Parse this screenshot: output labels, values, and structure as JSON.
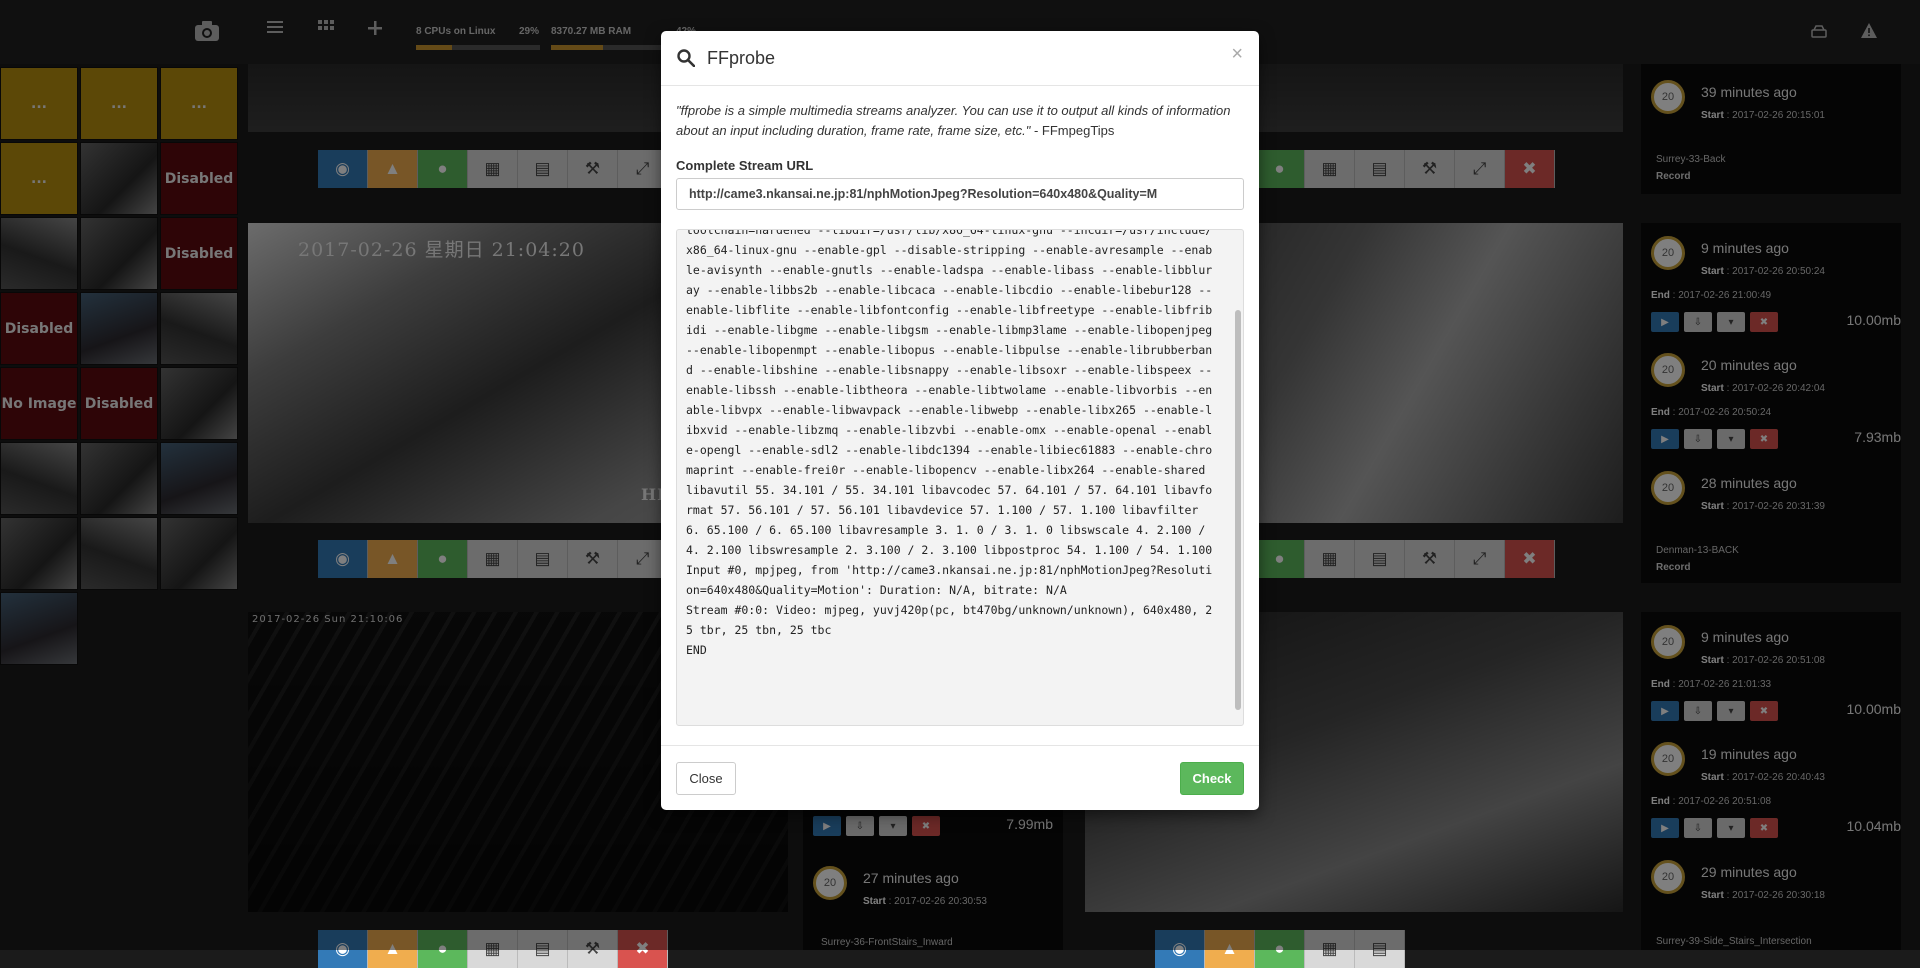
{
  "topbar": {
    "cpu_label": "8 CPUs on Linux",
    "cpu_percent": "29%",
    "ram_label": "8370.27 MB RAM",
    "ram_percent": "42%",
    "cpu_fraction": 0.29,
    "ram_fraction": 0.42
  },
  "left_grid": {
    "tiles": [
      "...",
      "...",
      "...",
      "...",
      "Disabled",
      "Disabled",
      "Disabled",
      "No Image",
      "Disabled"
    ]
  },
  "cameras": {
    "cam1_timestamp": "2017-02-26 星期日 21:04:20",
    "cam1_corner": "HI",
    "cam3_timestamp": "2017-02-26 Sun 21:10:06"
  },
  "recordings": {
    "panel1": [
      {
        "ago": "39 minutes ago",
        "start_label": "Start",
        "start": "2017-02-26 20:15:01",
        "circle": "20"
      }
    ],
    "panel1_camera": "Surrey-33-Back",
    "panel1_mode": "Record",
    "panel2": [
      {
        "ago": "9 minutes ago",
        "start_label": "Start",
        "start": "2017-02-26 20:50:24",
        "end_label": "End",
        "end": "2017-02-26 21:00:49",
        "size": "10.00mb",
        "circle": "20"
      },
      {
        "ago": "20 minutes ago",
        "start_label": "Start",
        "start": "2017-02-26 20:42:04",
        "end_label": "End",
        "end": "2017-02-26 20:50:24",
        "size": "7.93mb",
        "circle": "20"
      },
      {
        "ago": "28 minutes ago",
        "start_label": "Start",
        "start": "2017-02-26 20:31:39",
        "circle": "20"
      }
    ],
    "panel2_camera": "Denman-13-BACK",
    "panel2_mode": "Record",
    "panel3": [
      {
        "ago": "9 minutes ago",
        "start_label": "Start",
        "start": "2017-02-26 20:51:08",
        "end_label": "End",
        "end": "2017-02-26 21:01:33",
        "size": "10.00mb",
        "circle": "20"
      },
      {
        "ago": "19 minutes ago",
        "start_label": "Start",
        "start": "2017-02-26 20:40:43",
        "end_label": "End",
        "end": "2017-02-26 20:51:08",
        "size": "10.04mb",
        "circle": "20"
      },
      {
        "ago": "29 minutes ago",
        "start_label": "Start",
        "start": "2017-02-26 20:30:18",
        "circle": "20"
      }
    ],
    "panel3_camera": "Surrey-39-Side_Stairs_Intersection",
    "mid_size": "7.99mb",
    "mid_rec": {
      "ago": "27 minutes ago",
      "start_label": "Start",
      "start": "2017-02-26 20:30:53",
      "circle": "20"
    },
    "mid_camera": "Surrey-36-FrontStairs_Inward"
  },
  "modal": {
    "title": "FFprobe",
    "close_x": "×",
    "description_quote": "\"ffprobe is a simple multimedia streams analyzer. You can use it to output all kinds of information about an input including duration, frame rate, frame size, etc.\"",
    "description_source": " - FFmpegTips",
    "url_label": "Complete Stream URL",
    "url_value": "http://came3.nkansai.ne.jp:81/nphMotionJpeg?Resolution=640x480&Quality=M",
    "output": "toolchain=hardened --libdir=/usr/lib/x86_64-linux-gnu --incdir=/usr/include/x86_64-linux-gnu --enable-gpl --disable-stripping --enable-avresample --enable-avisynth --enable-gnutls --enable-ladspa --enable-libass --enable-libbluray --enable-libbs2b --enable-libcaca --enable-libcdio --enable-libebur128 --enable-libflite --enable-libfontconfig --enable-libfreetype --enable-libfribidi --enable-libgme --enable-libgsm --enable-libmp3lame --enable-libopenjpeg --enable-libopenmpt --enable-libopus --enable-libpulse --enable-librubberband --enable-libshine --enable-libsnappy --enable-libsoxr --enable-libspeex --enable-libssh --enable-libtheora --enable-libtwolame --enable-libvorbis --enable-libvpx --enable-libwavpack --enable-libwebp --enable-libx265 --enable-libxvid --enable-libzmq --enable-libzvbi --enable-omx --enable-openal --enable-opengl --enable-sdl2 --enable-libdc1394 --enable-libiec61883 --enable-chromaprint --enable-frei0r --enable-libopencv --enable-libx264 --enable-shared\nlibavutil 55. 34.101 / 55. 34.101 libavcodec 57. 64.101 / 57. 64.101 libavformat 57. 56.101 / 57. 56.101 libavdevice 57. 1.100 / 57. 1.100 libavfilter 6. 65.100 / 6. 65.100 libavresample 3. 1. 0 / 3. 1. 0 libswscale 4. 2.100 / 4. 2.100 libswresample 2. 3.100 / 2. 3.100 libpostproc 54. 1.100 / 54. 1.100\nInput #0, mpjpeg, from 'http://came3.nkansai.ne.jp:81/nphMotionJpeg?Resolution=640x480&Quality=Motion': Duration: N/A, bitrate: N/A\nStream #0:0: Video: mjpeg, yuvj420p(pc, bt470bg/unknown/unknown), 640x480, 25 tbr, 25 tbn, 25 tbc\nEND",
    "close_button": "Close",
    "check_button": "Check"
  },
  "colors": {
    "accent_yellow": "#b8900f",
    "disabled_red": "#5c0a0e",
    "primary_blue": "#337ab7",
    "success_green": "#5cb85c",
    "danger_red": "#d9534f",
    "warning_orange": "#f0ad4e"
  }
}
